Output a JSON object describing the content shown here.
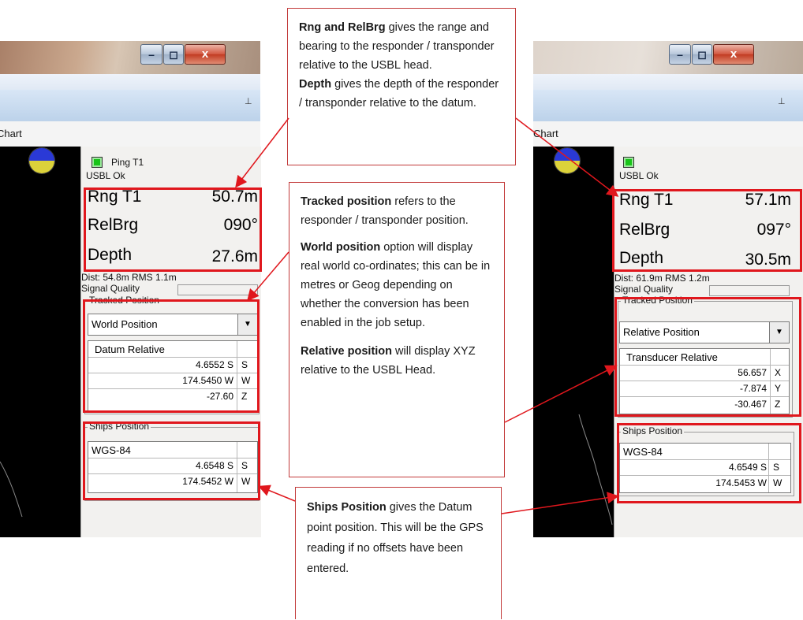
{
  "left_window": {
    "tab_label": "Chart",
    "status_label": "Ping T1",
    "status_text": "USBL Ok",
    "readings": [
      {
        "label": "Rng T1",
        "value": "50.7m"
      },
      {
        "label": "RelBrg",
        "value": "090°"
      },
      {
        "label": "Depth",
        "value": "27.6m"
      }
    ],
    "dist_line": "Dist: 54.8m RMS 1.1m",
    "signal_label": "Signal Quality",
    "tracked_title": "Tracked Position",
    "tracked_option": "World Position",
    "tracked_header": "Datum Relative",
    "tracked_rows": [
      {
        "value": "4.6552 S",
        "unit": "S"
      },
      {
        "value": "174.5450 W",
        "unit": "W"
      },
      {
        "value": "-27.60",
        "unit": "Z"
      }
    ],
    "ships_title": "Ships Position",
    "ships_header": "WGS-84",
    "ships_rows": [
      {
        "value": "4.6548 S",
        "unit": "S"
      },
      {
        "value": "174.5452 W",
        "unit": "W"
      }
    ]
  },
  "right_window": {
    "tab_label": "Chart",
    "status_text": "USBL Ok",
    "readings": [
      {
        "label": "Rng T1",
        "value": "57.1m"
      },
      {
        "label": "RelBrg",
        "value": "097°"
      },
      {
        "label": "Depth",
        "value": "30.5m"
      }
    ],
    "dist_line": "Dist: 61.9m RMS 1.2m",
    "signal_label": "Signal Quality",
    "tracked_title": "Tracked Position",
    "tracked_option": "Relative Position",
    "tracked_header": "Transducer Relative",
    "tracked_rows": [
      {
        "value": "56.657",
        "unit": "X"
      },
      {
        "value": "-7.874",
        "unit": "Y"
      },
      {
        "value": "-30.467",
        "unit": "Z"
      }
    ],
    "ships_title": "Ships Position",
    "ships_header": "WGS-84",
    "ships_rows": [
      {
        "value": "4.6549 S",
        "unit": "S"
      },
      {
        "value": "174.5453 W",
        "unit": "W"
      }
    ]
  },
  "window_buttons": {
    "minimize": "–",
    "maximize": "◻",
    "close": "x"
  },
  "pin_glyph": "⊥",
  "callouts": {
    "range": {
      "p1_bold": "Rng and RelBrg",
      "p1_text": " gives the range and bearing to the responder / transponder relative to the USBL head.",
      "p2_bold": "Depth ",
      "p2_text": "gives the depth of the responder / transponder relative to the datum."
    },
    "tracked": {
      "p1_bold": "Tracked position",
      "p1_text": " refers to the responder / transponder position.",
      "p2_bold": "World position",
      "p2_text": " option will display real world co-ordinates; this can be in metres or Geog depending on whether the conversion has  been enabled in the job setup.",
      "p3_bold": "Relative position",
      "p3_text": " will display XYZ relative to the USBL Head."
    },
    "ships": {
      "p1_bold": "Ships Position",
      "p1_text": " gives the Datum point position. This will be the GPS reading if no offsets have  been entered."
    }
  },
  "colors": {
    "highlight_red": "#e0171d",
    "callout_border": "#c23a3a",
    "led_green": "#19c419",
    "compass_blue": "#2a39d6",
    "compass_yellow": "#dcd23a"
  }
}
